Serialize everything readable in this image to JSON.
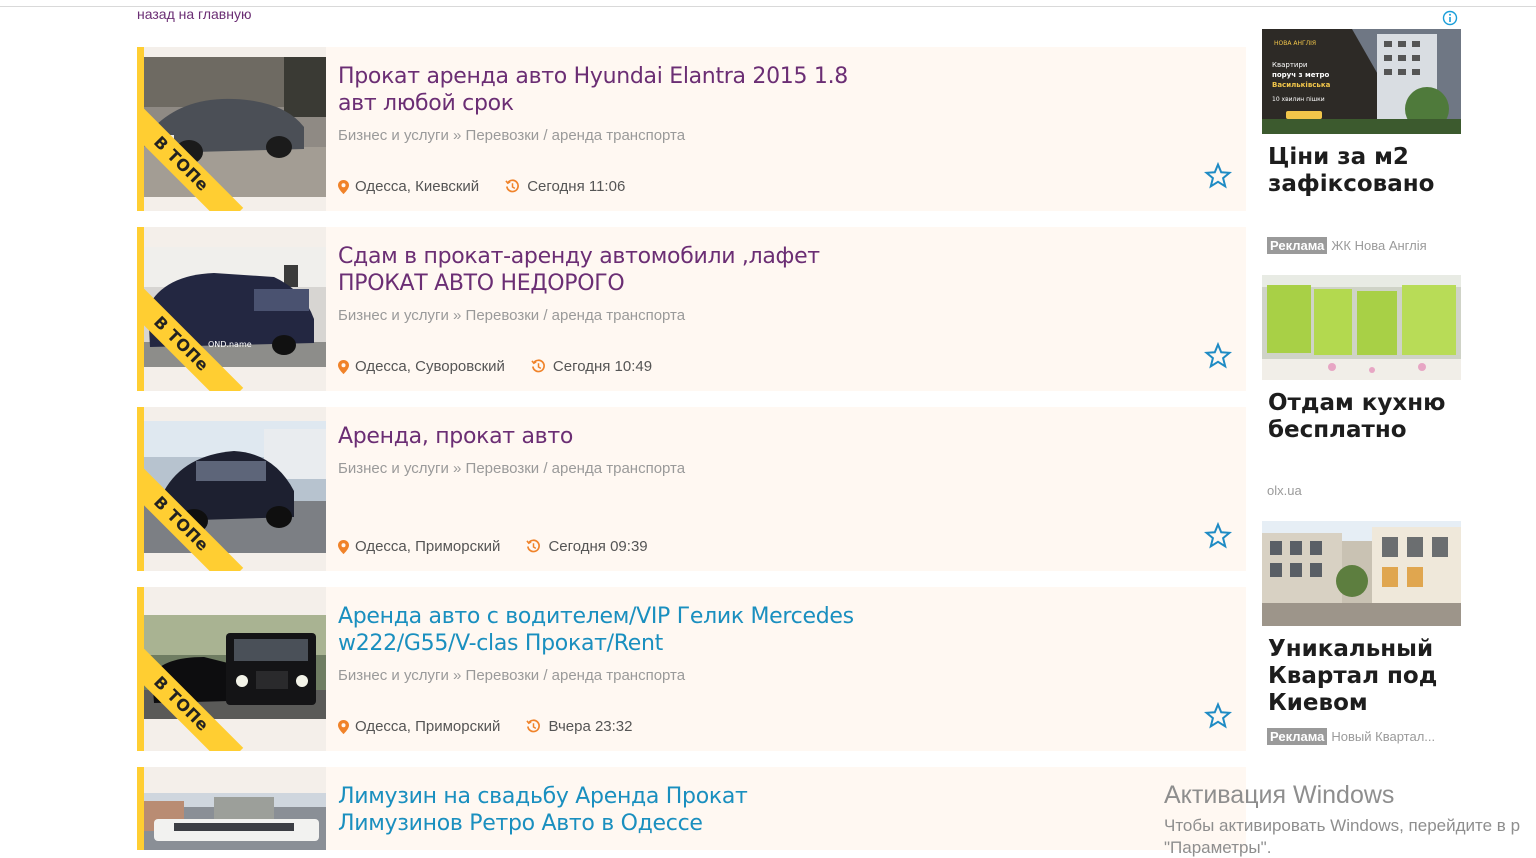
{
  "nav": {
    "back_label": "назад на главную"
  },
  "listings": [
    {
      "title": "Прокат аренда авто Hyundai Elantra 2015 1.8 авт любой срок",
      "category": "Бизнес и услуги » Перевозки / аренда транспорта",
      "location": "Одесса, Киевский",
      "time": "Сегодня 11:06",
      "badge": "В ТОПе"
    },
    {
      "title": "Сдам в прокат-аренду автомобили ,лафет ПРОКАТ АВТО НЕДОРОГО",
      "category": "Бизнес и услуги » Перевозки / аренда транспорта",
      "location": "Одесса, Суворовский",
      "time": "Сегодня 10:49",
      "badge": "В ТОПе",
      "watermark": "OND.name"
    },
    {
      "title": "Аренда, прокат авто",
      "category": "Бизнес и услуги » Перевозки / аренда транспорта",
      "location": "Одесса, Приморский",
      "time": "Сегодня 09:39",
      "badge": "В ТОПе"
    },
    {
      "title": "Аренда авто с водителем/VIP Гелик Mercedes w222/G55/V-clas Прокат/Rent",
      "category": "Бизнес и услуги » Перевозки / аренда транспорта",
      "location": "Одесса, Приморский",
      "time": "Вчера 23:32",
      "badge": "В ТОПе"
    },
    {
      "title": "Лимузин на свадьбу Аренда Прокат Лимузинов Ретро Авто в Одессе"
    }
  ],
  "ads": [
    {
      "title": "Ціни за м2 зафіксовано",
      "tag": "Реклама",
      "source": "ЖК Нова Англія",
      "image_text": {
        "brand": "НОВА АНГЛІЯ",
        "line1": "Квартири",
        "line2": "поруч з метро",
        "line3": "Васильківська",
        "line4": "10 хвилин пішки"
      }
    },
    {
      "title": "Отдам кухню бесплатно",
      "source": "olx.ua"
    },
    {
      "title": "Уникальный Квартал под Киевом",
      "tag": "Реклама",
      "source": "Новый Квартал..."
    }
  ],
  "windows_watermark": {
    "line1": "Активация Windows",
    "line2": "Чтобы активировать Windows, перейдите в р",
    "line3": "\"Параметры\"."
  },
  "colors": {
    "title_visited": "#6b2e74",
    "title_link": "#1a8fbf",
    "badge_yellow": "#ffce32",
    "listing_bg": "#fff8f2",
    "icon_orange": "#f0832a",
    "star_blue": "#1f8bc4"
  },
  "icons": [
    "location-pin-icon",
    "clock-history-icon",
    "favorite-star-icon",
    "info-icon"
  ]
}
